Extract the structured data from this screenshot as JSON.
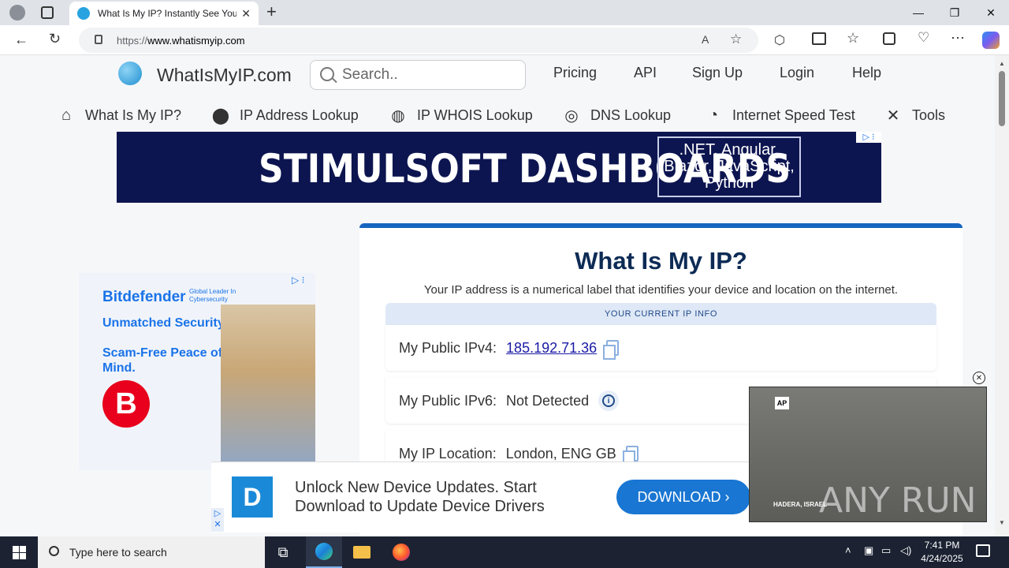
{
  "browser": {
    "tab_title": "What Is My IP? Instantly See Your",
    "tab_close": "✕",
    "new_tab": "+",
    "url_scheme": "https://",
    "url_host": "www.whatismyip.com",
    "win_minimize": "—",
    "win_maximize": "❐",
    "win_close": "✕"
  },
  "site": {
    "logo_text": "WhatIsMyIP.com",
    "search_placeholder": "Search..",
    "top_links": [
      "Pricing",
      "API",
      "Sign Up",
      "Login",
      "Help"
    ],
    "subnav": [
      {
        "label": "What Is My IP?",
        "icon": "home-icon"
      },
      {
        "label": "IP Address Lookup",
        "icon": "location-pin-icon"
      },
      {
        "label": "IP WHOIS Lookup",
        "icon": "globe-icon"
      },
      {
        "label": "DNS Lookup",
        "icon": "dns-icon"
      },
      {
        "label": "Internet Speed Test",
        "icon": "speedometer-icon"
      },
      {
        "label": "Tools",
        "icon": "tools-icon"
      }
    ]
  },
  "banner_ad": {
    "headline": "STIMULSOFT DASHBOARDS",
    "tech": ".NET, Angular,\nBlazor, JavaScript,\nPython"
  },
  "side_ad": {
    "brand": "Bitdefender",
    "tagline": "Global Leader In Cybersecurity",
    "line1": "Unmatched Security.",
    "line2": "Scam-Free Peace of Mind.",
    "badge": "B"
  },
  "main": {
    "title": "What Is My IP?",
    "subtitle": "Your IP address is a numerical label that identifies your device and location on the internet.",
    "section_header": "YOUR CURRENT IP INFO",
    "rows": [
      {
        "label": "My Public IPv4:",
        "value": "185.192.71.36"
      },
      {
        "label": "My Public IPv6:",
        "value": "Not Detected"
      },
      {
        "label": "My IP Location:",
        "value": "London, ENG GB"
      }
    ]
  },
  "bottom_ad": {
    "message": "Unlock New Device Updates. Start Download to Update Device Drivers",
    "button": "DOWNLOAD ›",
    "logo": "D"
  },
  "video": {
    "badge": "AP",
    "location": "HADERA, ISRAEL",
    "watermark": "ANY RUN"
  },
  "taskbar": {
    "search_placeholder": "Type here to search",
    "time": "7:41 PM",
    "date": "4/24/2025"
  },
  "colors": {
    "accent": "#1565c0",
    "banner_bg": "#0d1550",
    "title": "#0d2b55"
  }
}
